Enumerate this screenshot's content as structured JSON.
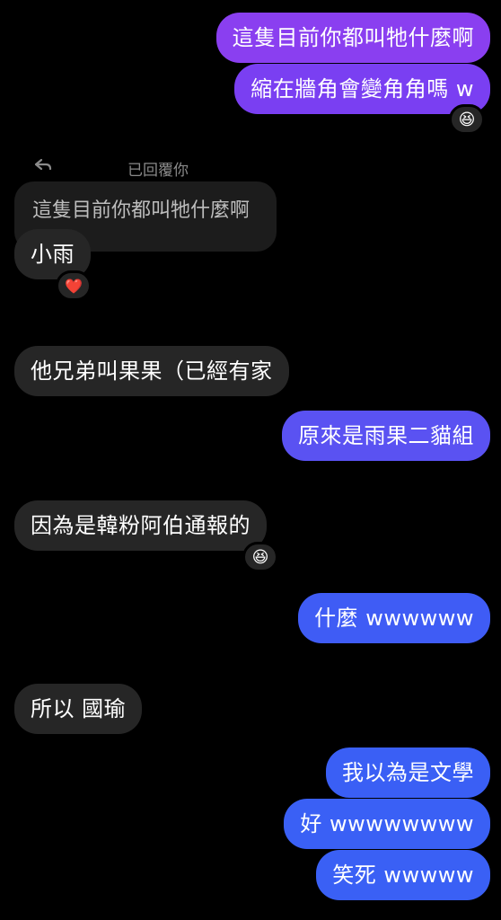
{
  "messages": {
    "m1": "這隻目前你都叫牠什麼啊",
    "m2": "縮在牆角會變角角嗎 w",
    "reply_label": "已回覆你",
    "quoted": "這隻目前你都叫牠什麼啊",
    "m3": "小雨",
    "m4": "他兄弟叫果果（已經有家",
    "m5": "原來是雨果二貓組",
    "m6": "因為是韓粉阿伯通報的",
    "m7": "什麼 wwwwww",
    "m8": "所以 國瑜",
    "m9": "我以為是文學",
    "m10": "好 wwwwwwww",
    "m11": "笑死 wwwww"
  },
  "reactions": {
    "r1": "😆",
    "r2": "❤️",
    "r3": "😆"
  },
  "colors": {
    "outgoing_purple": "#7b3ff2",
    "outgoing_indigo": "#5a52f2",
    "outgoing_blue": "#3b5ff5",
    "incoming": "#262626",
    "background": "#000000"
  },
  "icons": {
    "reply": "reply-arrow-icon"
  }
}
